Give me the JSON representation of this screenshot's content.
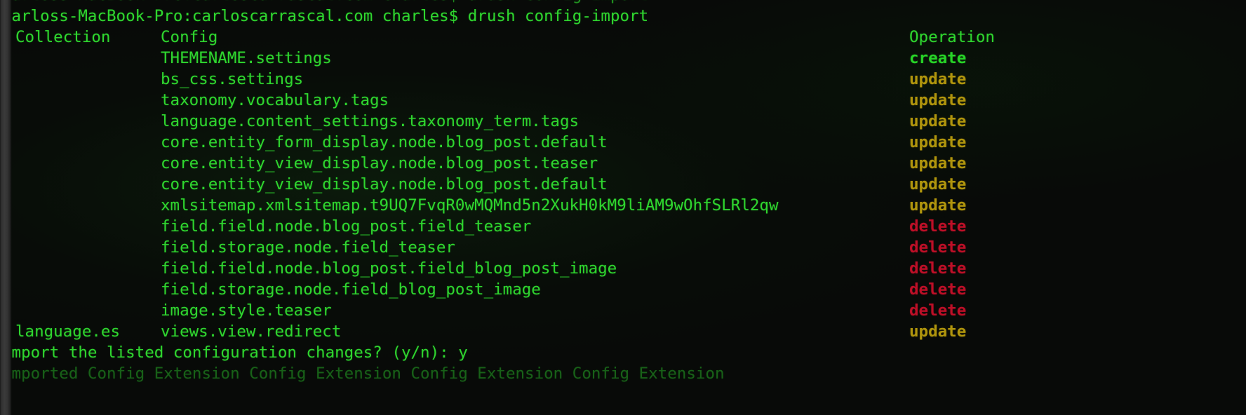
{
  "terminal": {
    "shell_prompt": "Carloss-MacBook-Pro:carloscarrascal.com charles$ ",
    "command": "drush config-import",
    "prompt_line": "Carloss-MacBook-Pro:carloscarrascal.com charles$ drush config-import",
    "scrolled_off_top_line": "Carloss-MacBook-Pro:carloscarrascal.com charles$ drush config-import",
    "colors": {
      "background": "#080a08",
      "foreground": "#2fd62f",
      "create": "#27d427",
      "update": "#b0950d",
      "delete": "#bd0f27",
      "gutter": "#343434"
    }
  },
  "table": {
    "headers": {
      "collection": "Collection",
      "config": "Config",
      "operation": "Operation"
    },
    "rows": [
      {
        "collection": "",
        "config": "THEMENAME.settings",
        "operation": "create",
        "op_class": "op-create"
      },
      {
        "collection": "",
        "config": "bs_css.settings",
        "operation": "update",
        "op_class": "op-update"
      },
      {
        "collection": "",
        "config": "taxonomy.vocabulary.tags",
        "operation": "update",
        "op_class": "op-update"
      },
      {
        "collection": "",
        "config": "language.content_settings.taxonomy_term.tags",
        "operation": "update",
        "op_class": "op-update"
      },
      {
        "collection": "",
        "config": "core.entity_form_display.node.blog_post.default",
        "operation": "update",
        "op_class": "op-update"
      },
      {
        "collection": "",
        "config": "core.entity_view_display.node.blog_post.teaser",
        "operation": "update",
        "op_class": "op-update"
      },
      {
        "collection": "",
        "config": "core.entity_view_display.node.blog_post.default",
        "operation": "update",
        "op_class": "op-update"
      },
      {
        "collection": "",
        "config": "xmlsitemap.xmlsitemap.t9UQ7FvqR0wMQMnd5n2XukH0kM9liAM9wOhfSLRl2qw",
        "operation": "update",
        "op_class": "op-update"
      },
      {
        "collection": "",
        "config": "field.field.node.blog_post.field_teaser",
        "operation": "delete",
        "op_class": "op-delete"
      },
      {
        "collection": "",
        "config": "field.storage.node.field_teaser",
        "operation": "delete",
        "op_class": "op-delete"
      },
      {
        "collection": "",
        "config": "field.field.node.blog_post.field_blog_post_image",
        "operation": "delete",
        "op_class": "op-delete"
      },
      {
        "collection": "",
        "config": "field.storage.node.field_blog_post_image",
        "operation": "delete",
        "op_class": "op-delete"
      },
      {
        "collection": "",
        "config": "image.style.teaser",
        "operation": "delete",
        "op_class": "op-delete"
      },
      {
        "collection": "language.es",
        "config": "views.view.redirect",
        "operation": "update",
        "op_class": "op-update"
      }
    ]
  },
  "confirm": {
    "question": "Import the listed configuration changes? (y/n): ",
    "answer": "y",
    "full_line": "Import the listed configuration changes? (y/n): y"
  },
  "next_output": {
    "partial_line": "Imported Config Extension Config Extension Config Extension Config Extension"
  }
}
